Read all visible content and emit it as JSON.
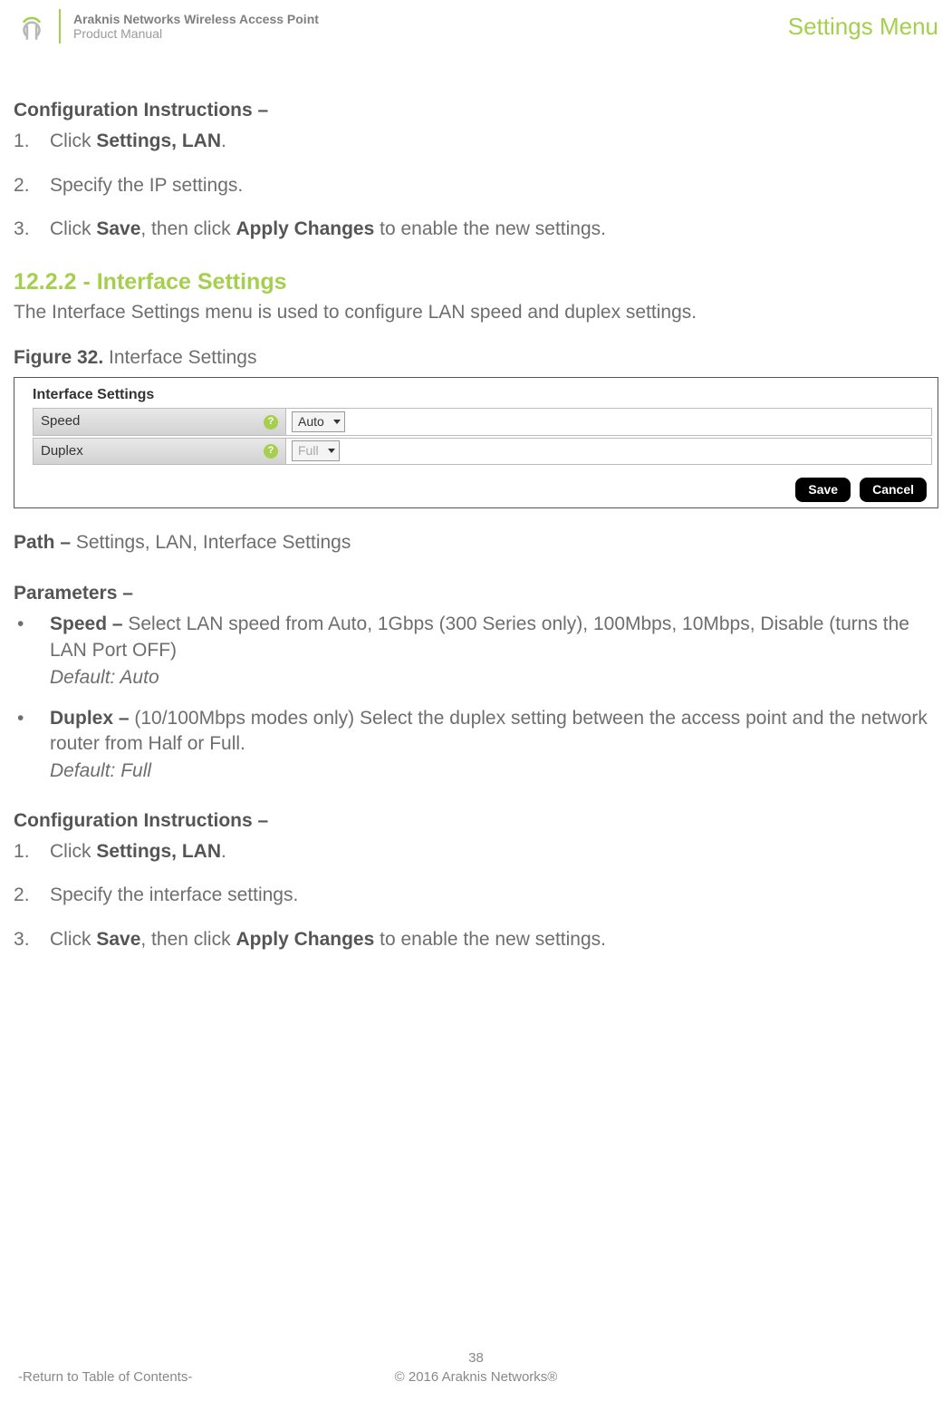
{
  "header": {
    "title1": "Araknis Networks Wireless Access Point",
    "title2": "Product Manual",
    "menu": "Settings Menu"
  },
  "s1": {
    "heading": "Configuration Instructions –",
    "step1_a": "Click ",
    "step1_b": "Settings, LAN",
    "step1_c": ".",
    "step2": "Specify the IP settings.",
    "step3_a": "Click ",
    "step3_b": "Save",
    "step3_c": ", then click ",
    "step3_d": "Apply Changes",
    "step3_e": " to enable the new settings."
  },
  "s2": {
    "num": "12.2.2 - Interface Settings",
    "intro": "The Interface Settings menu is used to configure LAN speed and duplex settings.",
    "fig_num": "Figure 32.",
    "fig_title": " Interface Settings"
  },
  "shot": {
    "panel_title": "Interface Settings",
    "row1_label": "Speed",
    "row1_value": "Auto",
    "row2_label": "Duplex",
    "row2_value": "Full",
    "btn_save": "Save",
    "btn_cancel": "Cancel"
  },
  "path": {
    "lbl": "Path – ",
    "val": "Settings, LAN, Interface Settings"
  },
  "params": {
    "heading": "Parameters –",
    "p1_name": "Speed – ",
    "p1_text": "Select LAN speed from Auto, 1Gbps (300 Series only), 100Mbps, 10Mbps, Disable (turns the LAN Port OFF)",
    "p1_def": "Default: Auto",
    "p2_name": "Duplex – ",
    "p2_text": "(10/100Mbps modes only) Select the duplex setting between the access point and the network router from Half or Full.",
    "p2_def": "Default: Full"
  },
  "s3": {
    "heading": "Configuration Instructions –",
    "step1_a": "Click ",
    "step1_b": "Settings, LAN",
    "step1_c": ".",
    "step2": "Specify the interface settings.",
    "step3_a": "Click ",
    "step3_b": "Save",
    "step3_c": ", then click ",
    "step3_d": "Apply Changes",
    "step3_e": " to enable the new settings."
  },
  "footer": {
    "page": "38",
    "copyright": "© 2016 Araknis Networks®",
    "toc": "-Return to Table of Contents-"
  }
}
